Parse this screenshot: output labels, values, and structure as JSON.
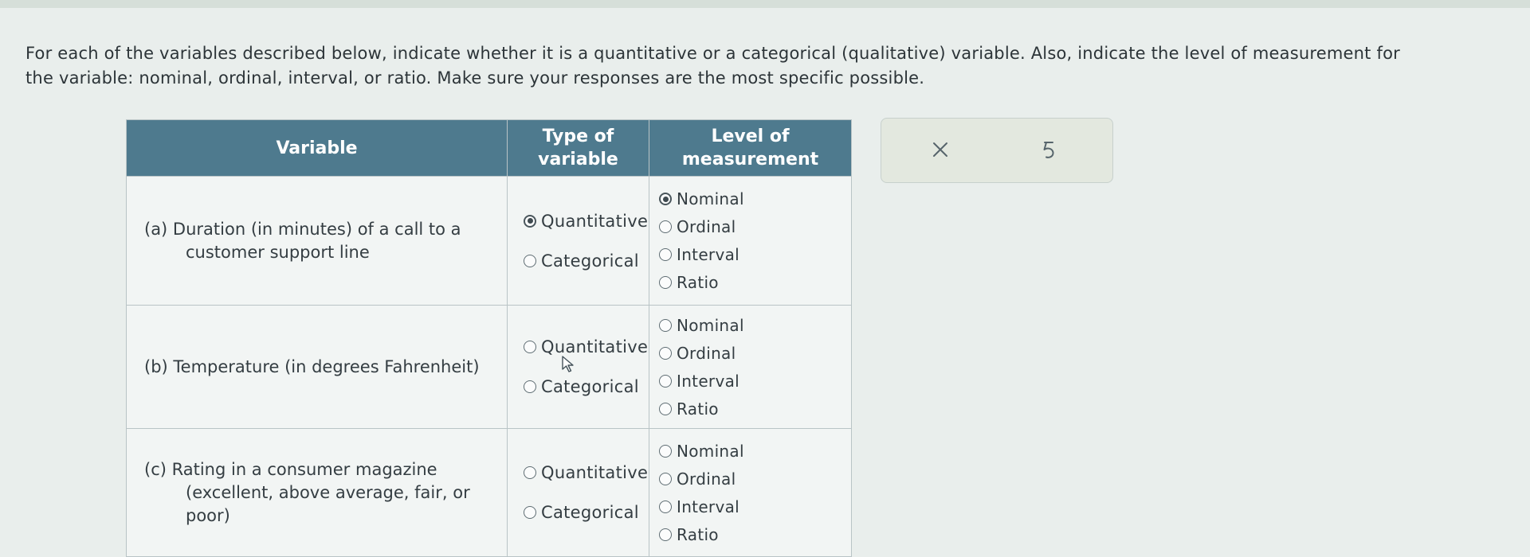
{
  "question": {
    "line1": "For each of the variables described below, indicate whether it is a quantitative or a categorical (qualitative) variable. Also, indicate the level of measurement for",
    "line2": "the variable: nominal, ordinal, interval, or ratio. Make sure your responses are the most specific possible."
  },
  "table": {
    "headers": {
      "variable": "Variable",
      "type_line1": "Type of",
      "type_line2": "variable",
      "level_line1": "Level of",
      "level_line2": "measurement"
    },
    "rows": [
      {
        "variable": "(a) Duration (in minutes) of a call to a customer support line",
        "type_options": [
          "Quantitative",
          "Categorical"
        ],
        "type_selected": "Quantitative",
        "level_options": [
          "Nominal",
          "Ordinal",
          "Interval",
          "Ratio"
        ],
        "level_selected": "Nominal"
      },
      {
        "variable": "(b) Temperature (in degrees Fahrenheit)",
        "type_options": [
          "Quantitative",
          "Categorical"
        ],
        "type_selected": "",
        "level_options": [
          "Nominal",
          "Ordinal",
          "Interval",
          "Ratio"
        ],
        "level_selected": ""
      },
      {
        "variable": "(c) Rating in a consumer magazine (excellent, above average, fair, or poor)",
        "type_options": [
          "Quantitative",
          "Categorical"
        ],
        "type_selected": "",
        "level_options": [
          "Nominal",
          "Ordinal",
          "Interval",
          "Ratio"
        ],
        "level_selected": ""
      }
    ]
  },
  "toolbar": {
    "close_icon": "close-icon",
    "undo_icon": "undo-icon"
  },
  "colors": {
    "header_bg": "#4e7a8e",
    "page_bg": "#e9eeec",
    "toolbar_bg": "#e3e8df"
  }
}
